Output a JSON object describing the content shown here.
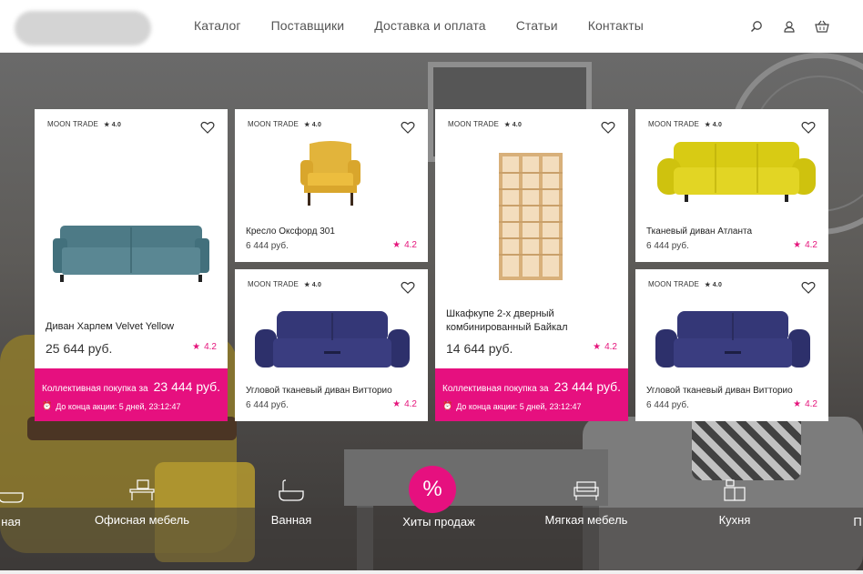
{
  "header": {
    "nav": [
      "Каталог",
      "Поставщики",
      "Доставка и оплата",
      "Статьи",
      "Контакты"
    ],
    "icons": [
      "search-icon",
      "user-icon",
      "basket-icon"
    ]
  },
  "colors": {
    "accent": "#e6107f",
    "text": "#333333"
  },
  "cards": [
    {
      "seller": "MOON TRADE",
      "seller_rating": "4.0",
      "name": "Диван Харлем Velvet Yellow",
      "price": "25 644 руб.",
      "rating": "4.2",
      "promo_label": "Коллективная покупка за",
      "promo_price": "23 444 руб.",
      "promo_timer": "До конца акции: 5 дней, 23:12:47"
    },
    {
      "seller": "MOON TRADE",
      "seller_rating": "4.0",
      "name": "Кресло Оксфорд 301",
      "price": "6 444 руб.",
      "rating": "4.2"
    },
    {
      "seller": "MOON TRADE",
      "seller_rating": "4.0",
      "name": "Угловой тканевый диван Витторио",
      "price": "6 444 руб.",
      "rating": "4.2"
    },
    {
      "seller": "MOON TRADE",
      "seller_rating": "4.0",
      "name_line1": "Шкафкупе 2-х дверный",
      "name_line2": "комбинированный Байкал",
      "price": "14 644 руб.",
      "rating": "4.2",
      "promo_label": "Коллективная покупка за",
      "promo_price": "23 444 руб.",
      "promo_timer": "До конца акции: 5 дней, 23:12:47"
    },
    {
      "seller": "MOON TRADE",
      "seller_rating": "4.0",
      "name": "Тканевый диван Атланта",
      "price": "6 444 руб.",
      "rating": "4.2"
    },
    {
      "seller": "MOON TRADE",
      "seller_rating": "4.0",
      "name": "Угловой тканевый диван Витторио",
      "price": "6 444 руб.",
      "rating": "4.2"
    }
  ],
  "categories": [
    {
      "label": "ная",
      "icon": "bath-icon"
    },
    {
      "label": "Офисная мебель",
      "icon": "office-desk-icon"
    },
    {
      "label": "Ванная",
      "icon": "bathtub-icon"
    },
    {
      "label": "Хиты продаж",
      "icon": "percent-icon"
    },
    {
      "label": "Мягкая мебель",
      "icon": "sofa-icon"
    },
    {
      "label": "Кухня",
      "icon": "kitchen-icon"
    },
    {
      "label": "П",
      "icon": ""
    }
  ]
}
